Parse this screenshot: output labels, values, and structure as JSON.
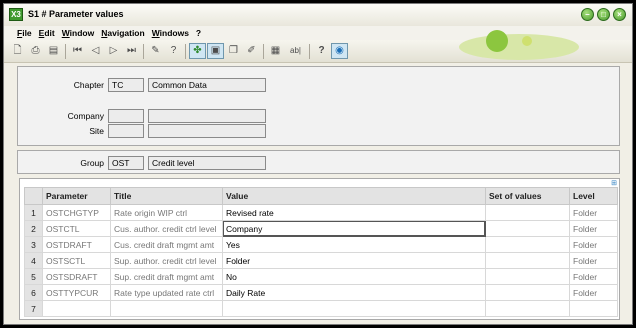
{
  "window": {
    "title": "S1 # Parameter values",
    "app_icon": "X3"
  },
  "menu": [
    "File",
    "Edit",
    "Window",
    "Navigation",
    "Windows",
    "?"
  ],
  "toolbar": {
    "icons": [
      "new-document-icon",
      "print-icon",
      "print-preview-icon",
      "first-record-icon",
      "previous-record-icon",
      "next-record-icon",
      "last-record-icon",
      "attachment-icon",
      "help-question-icon",
      "tree-view-icon",
      "window-icon",
      "copy-icon",
      "edit-icon",
      "report-icon",
      "text-field-icon",
      "help-icon",
      "globe-icon"
    ],
    "text_button_label": "ab|"
  },
  "header": {
    "chapter_label": "Chapter",
    "chapter_code": "TC",
    "chapter_name": "Common Data",
    "company_label": "Company",
    "company_code": "",
    "company_name": "",
    "site_label": "Site",
    "site_code": "",
    "site_name": ""
  },
  "group": {
    "label": "Group",
    "code": "OST",
    "name": "Credit level"
  },
  "table": {
    "columns": [
      "",
      "Parameter",
      "Title",
      "Value",
      "Set of values",
      "Level"
    ],
    "rows": [
      {
        "num": "1",
        "parameter": "OSTCHGTYP",
        "title": "Rate origin WIP ctrl",
        "value": "Revised rate",
        "set": "",
        "level": "Folder"
      },
      {
        "num": "2",
        "parameter": "OSTCTL",
        "title": "Cus. author. credit ctrl level",
        "value": "Company",
        "set": "",
        "level": "Folder"
      },
      {
        "num": "3",
        "parameter": "OSTDRAFT",
        "title": "Cus. credit draft mgmt amt",
        "value": "Yes",
        "set": "",
        "level": "Folder"
      },
      {
        "num": "4",
        "parameter": "OSTSCTL",
        "title": "Sup. author. credit ctrl level",
        "value": "Folder",
        "set": "",
        "level": "Folder"
      },
      {
        "num": "5",
        "parameter": "OSTSDRAFT",
        "title": "Sup. credit draft mgmt amt",
        "value": "No",
        "set": "",
        "level": "Folder"
      },
      {
        "num": "6",
        "parameter": "OSTTYPCUR",
        "title": "Rate type updated rate ctrl",
        "value": "Daily Rate",
        "set": "",
        "level": "Folder"
      },
      {
        "num": "7",
        "parameter": "",
        "title": "",
        "value": "",
        "set": "",
        "level": ""
      }
    ]
  }
}
